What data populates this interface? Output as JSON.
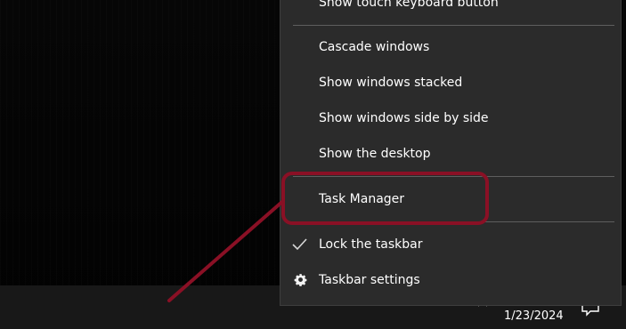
{
  "context_menu": {
    "items": [
      {
        "label": "Show touch keyboard button"
      },
      {
        "label": "Cascade windows"
      },
      {
        "label": "Show windows stacked"
      },
      {
        "label": "Show windows side by side"
      },
      {
        "label": "Show the desktop"
      },
      {
        "label": "Task Manager"
      },
      {
        "label": "Lock the taskbar",
        "checked": true,
        "icon": "check-icon"
      },
      {
        "label": "Taskbar settings",
        "icon": "gear-icon"
      }
    ]
  },
  "taskbar": {
    "date": "1/23/2024",
    "tray_icons": [
      "chevron-up-icon",
      "notification-icon"
    ]
  },
  "annotation": {
    "color": "#8a1025",
    "target": "Task Manager"
  }
}
